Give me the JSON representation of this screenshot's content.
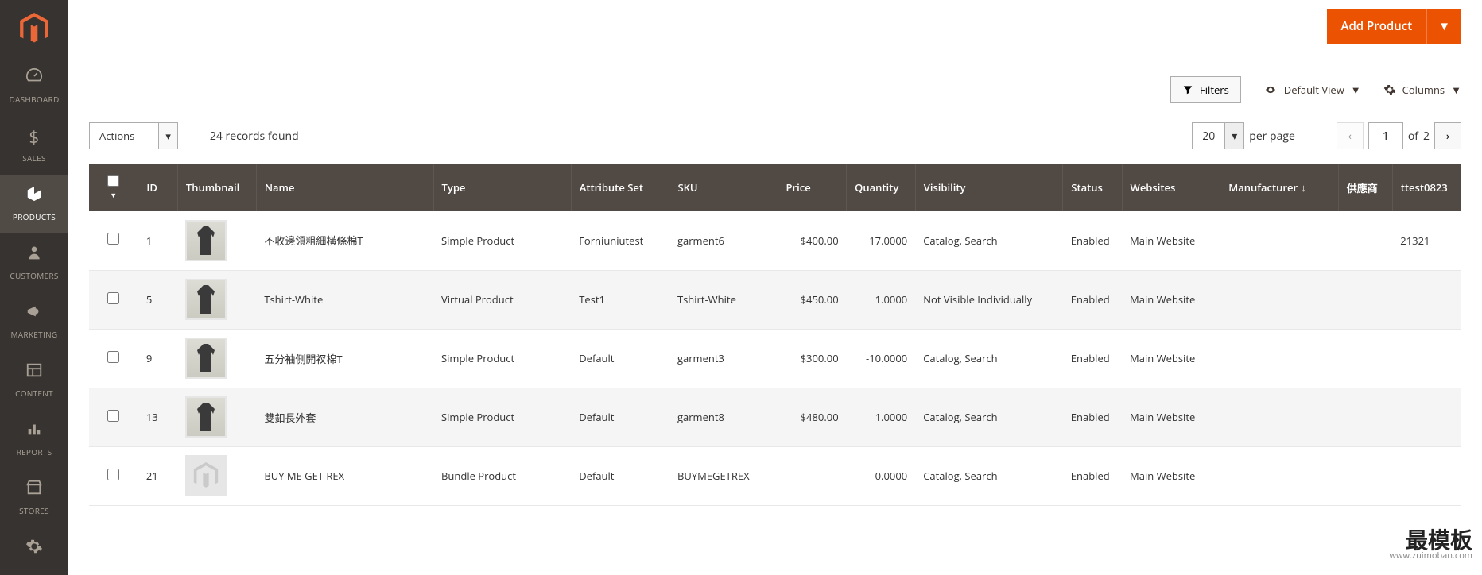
{
  "sidebar": {
    "items": [
      {
        "label": "DASHBOARD",
        "icon": "gauge"
      },
      {
        "label": "SALES",
        "icon": "dollar"
      },
      {
        "label": "PRODUCTS",
        "icon": "cube"
      },
      {
        "label": "CUSTOMERS",
        "icon": "person"
      },
      {
        "label": "MARKETING",
        "icon": "megaphone"
      },
      {
        "label": "CONTENT",
        "icon": "layout"
      },
      {
        "label": "REPORTS",
        "icon": "bars"
      },
      {
        "label": "STORES",
        "icon": "storefront"
      },
      {
        "label": "",
        "icon": "gear"
      }
    ]
  },
  "actions": {
    "add_product": "Add Product",
    "filters": "Filters",
    "default_view": "Default View",
    "columns": "Columns",
    "actions_label": "Actions"
  },
  "summary": {
    "records_found": "24 records found"
  },
  "paging": {
    "per_page": "20",
    "per_page_label": "per page",
    "page": "1",
    "of_label": "of",
    "total_pages": "2"
  },
  "columns": [
    "ID",
    "Thumbnail",
    "Name",
    "Type",
    "Attribute Set",
    "SKU",
    "Price",
    "Quantity",
    "Visibility",
    "Status",
    "Websites",
    "Manufacturer",
    "供應商",
    "ttest0823"
  ],
  "rows": [
    {
      "id": "1",
      "name": "不收邊領粗細橫條棉T",
      "type": "Simple Product",
      "attrset": "Forniuniutest",
      "sku": "garment6",
      "price": "$400.00",
      "qty": "17.0000",
      "vis": "Catalog, Search",
      "status": "Enabled",
      "websites": "Main Website",
      "manufacturer": "",
      "supplier": "",
      "ttest": "21321",
      "thumb": "img"
    },
    {
      "id": "5",
      "name": "Tshirt-White",
      "type": "Virtual Product",
      "attrset": "Test1",
      "sku": "Tshirt-White",
      "price": "$450.00",
      "qty": "1.0000",
      "vis": "Not Visible Individually",
      "status": "Enabled",
      "websites": "Main Website",
      "manufacturer": "",
      "supplier": "",
      "ttest": "",
      "thumb": "img"
    },
    {
      "id": "9",
      "name": "五分袖側開衩棉T",
      "type": "Simple Product",
      "attrset": "Default",
      "sku": "garment3",
      "price": "$300.00",
      "qty": "-10.0000",
      "vis": "Catalog, Search",
      "status": "Enabled",
      "websites": "Main Website",
      "manufacturer": "",
      "supplier": "",
      "ttest": "",
      "thumb": "img"
    },
    {
      "id": "13",
      "name": "雙釦長外套",
      "type": "Simple Product",
      "attrset": "Default",
      "sku": "garment8",
      "price": "$480.00",
      "qty": "1.0000",
      "vis": "Catalog, Search",
      "status": "Enabled",
      "websites": "Main Website",
      "manufacturer": "",
      "supplier": "",
      "ttest": "",
      "thumb": "img"
    },
    {
      "id": "21",
      "name": "BUY ME GET REX",
      "type": "Bundle Product",
      "attrset": "Default",
      "sku": "BUYMEGETREX",
      "price": "",
      "qty": "0.0000",
      "vis": "Catalog, Search",
      "status": "Enabled",
      "websites": "Main Website",
      "manufacturer": "",
      "supplier": "",
      "ttest": "",
      "thumb": "placeholder"
    }
  ],
  "watermark": {
    "main": "最模板",
    "sub": "www.zuimoban.com"
  }
}
